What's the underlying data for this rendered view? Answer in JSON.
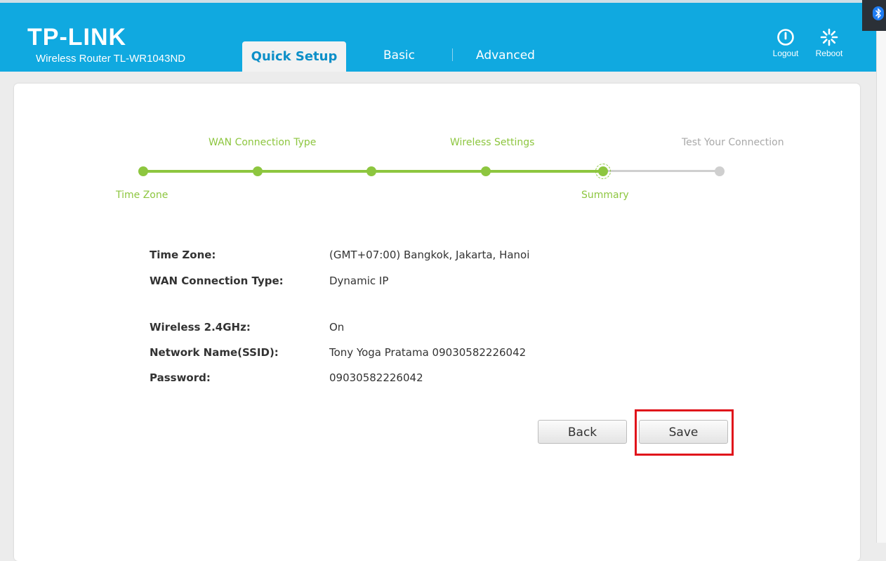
{
  "header": {
    "brand": "TP-LINK",
    "model": "Wireless Router TL-WR1043ND",
    "tabs": {
      "quick_setup": "Quick Setup",
      "basic": "Basic",
      "advanced": "Advanced"
    },
    "logout_label": "Logout",
    "reboot_label": "Reboot"
  },
  "progress": {
    "steps": {
      "time_zone": "Time Zone",
      "wan": "WAN Connection Type",
      "wireless": "Wireless Settings",
      "summary": "Summary",
      "test": "Test Your Connection"
    },
    "completed_steps": 5,
    "total_steps": 6
  },
  "summary": {
    "rows": [
      {
        "label": "Time Zone:",
        "value": "(GMT+07:00) Bangkok, Jakarta, Hanoi"
      },
      {
        "label": "WAN Connection Type:",
        "value": "Dynamic IP"
      },
      {
        "label": "Wireless 2.4GHz:",
        "value": "On"
      },
      {
        "label": "Network Name(SSID):",
        "value": "Tony Yoga Pratama 09030582226042"
      },
      {
        "label": "Password:",
        "value": "09030582226042"
      }
    ]
  },
  "buttons": {
    "back": "Back",
    "save": "Save"
  },
  "colors": {
    "header_blue": "#10a9e0",
    "active_tab_text": "#0c8fc8",
    "progress_green": "#8dc63f",
    "inactive_grey": "#cfcfcf",
    "highlight_red": "#e0141b"
  },
  "icons": {
    "logout": "power-icon",
    "reboot": "spinner-icon",
    "taskbar": "bluetooth-icon"
  }
}
